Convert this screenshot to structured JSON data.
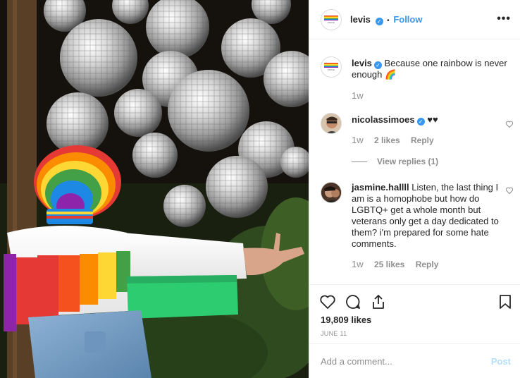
{
  "post": {
    "username": "levis",
    "follow_label": "Follow",
    "separator": "•",
    "more_label": "•••",
    "avatar_text": "PRIDE"
  },
  "caption": {
    "username": "levis",
    "text": "Because one rainbow is never enough 🌈",
    "time": "1w"
  },
  "comments": [
    {
      "username": "nicolassimoes",
      "verified": true,
      "text": "♥♥",
      "time": "1w",
      "likes": "2 likes",
      "reply_label": "Reply",
      "view_replies": "View replies (1)"
    },
    {
      "username": "jasmine.hallll",
      "verified": false,
      "text": "Listen, the last thing I am is a homophobe but how do LGBTQ+ get a whole month but veterans only get a day dedicated to them? i'm prepared for some hate comments.",
      "time": "1w",
      "likes": "25 likes",
      "reply_label": "Reply"
    }
  ],
  "stats": {
    "likes": "19,809 likes",
    "date": "JUNE 11"
  },
  "add_comment": {
    "placeholder": "Add a comment...",
    "post_label": "Post"
  },
  "icons": {
    "like": "heart-icon",
    "comment": "comment-bubble-icon",
    "share": "share-icon",
    "save": "bookmark-icon"
  },
  "colors": {
    "link_blue": "#3897f0",
    "post_disabled": "#b2dffc",
    "muted": "#8e8e8e"
  }
}
